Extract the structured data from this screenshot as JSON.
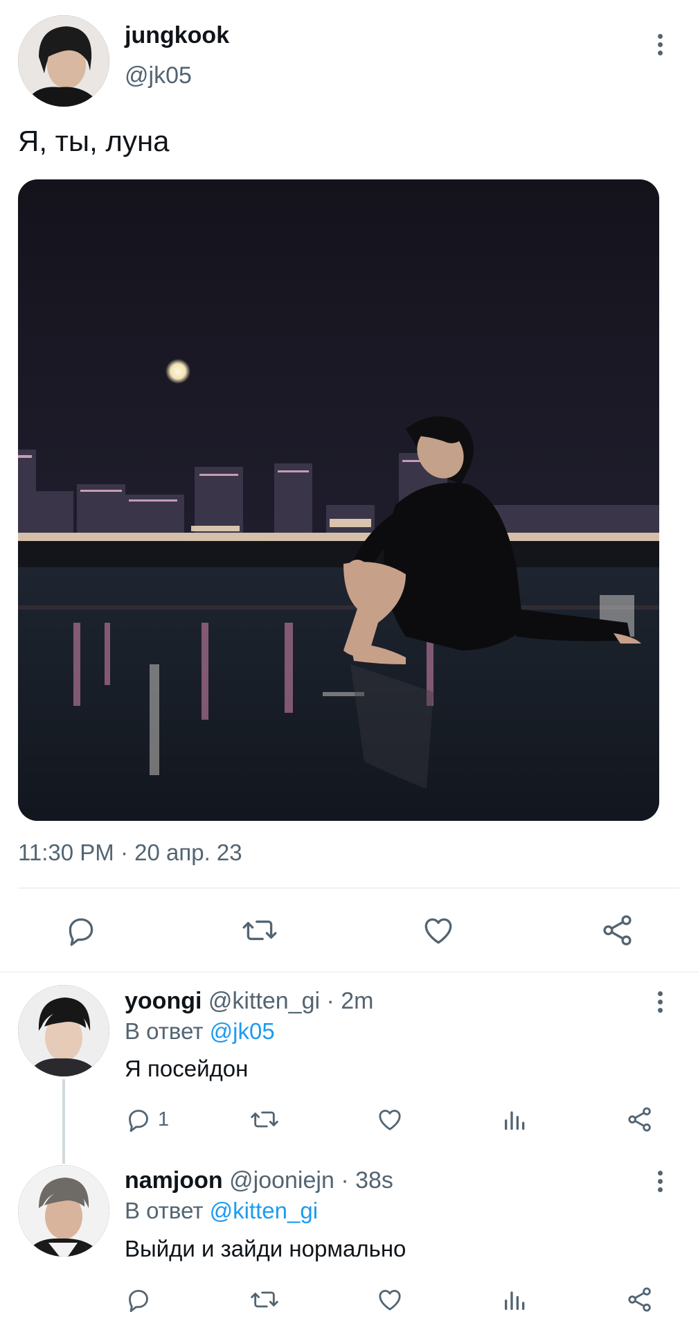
{
  "tweet": {
    "author_name": "jungkook",
    "author_handle": "@jk05",
    "text": "Я, ты, луна",
    "timestamp": "11:30 PM · 20 апр. 23",
    "actions": [
      "reply-icon",
      "retweet-icon",
      "like-icon",
      "share-icon"
    ]
  },
  "replies": [
    {
      "author_name": "yoongi",
      "author_handle": "@kitten_gi",
      "age": "· 2m",
      "reply_prefix": "В ответ",
      "reply_to": "@jk05",
      "text": "Я посейдон",
      "reply_count": "1",
      "actions": [
        "reply-icon",
        "retweet-icon",
        "like-icon",
        "views-icon",
        "share-icon"
      ]
    },
    {
      "author_name": "namjoon",
      "author_handle": "@jooniejn",
      "age": "· 38s",
      "reply_prefix": "В ответ",
      "reply_to": "@kitten_gi",
      "text": "Выйди и зайди нормально",
      "actions": [
        "reply-icon",
        "retweet-icon",
        "like-icon",
        "views-icon",
        "share-icon"
      ]
    }
  ],
  "colors": {
    "accent": "#1d9bf0",
    "muted": "#536471",
    "text": "#0f1419"
  }
}
